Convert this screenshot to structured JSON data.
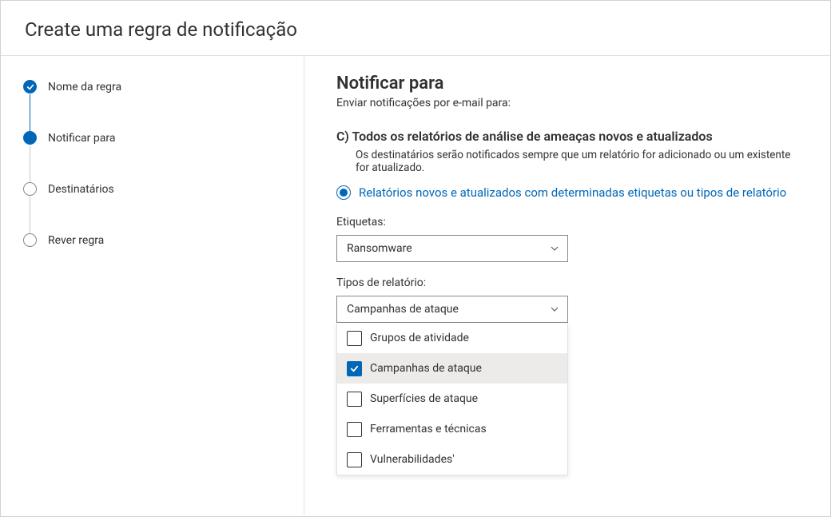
{
  "header": {
    "title": "Create uma regra de notificação"
  },
  "steps": [
    {
      "label": "Nome da regra",
      "state": "completed"
    },
    {
      "label": "Notificar para",
      "state": "current"
    },
    {
      "label": "Destinatários",
      "state": "pending"
    },
    {
      "label": "Rever regra",
      "state": "pending"
    }
  ],
  "main": {
    "heading": "Notificar para",
    "subtitle": "Enviar notificações por e-mail para:",
    "sectionC": {
      "title": "C) Todos os relatórios de análise de ameaças novos e atualizados",
      "desc": "Os destinatários serão notificados sempre que um relatório for adicionado ou um existente for atualizado."
    },
    "radio": {
      "label": "Relatórios novos e atualizados com determinadas etiquetas ou tipos de relatório",
      "selected": true
    },
    "tags": {
      "label": "Etiquetas:",
      "value": "Ransomware"
    },
    "reportTypes": {
      "label": "Tipos de relatório:",
      "value": "Campanhas de ataque",
      "options": [
        {
          "label": "Grupos de atividade",
          "checked": false
        },
        {
          "label": "Campanhas de ataque",
          "checked": true
        },
        {
          "label": "Superfícies de ataque",
          "checked": false
        },
        {
          "label": "Ferramentas e técnicas",
          "checked": false
        },
        {
          "label": "Vulnerabilidades'",
          "checked": false
        }
      ]
    }
  }
}
